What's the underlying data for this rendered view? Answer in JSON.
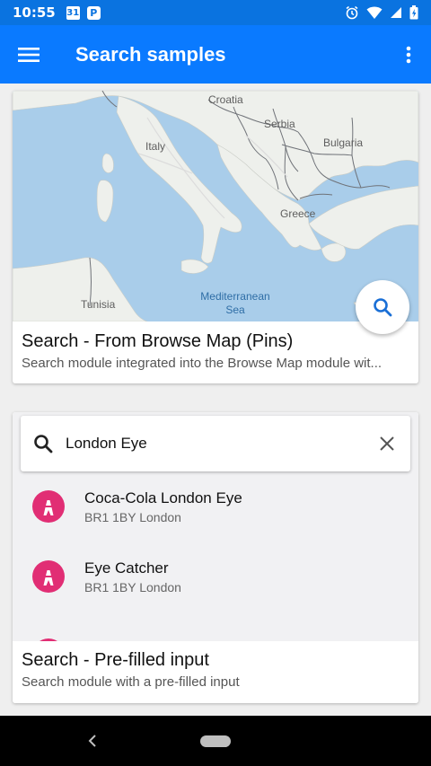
{
  "status_bar": {
    "time": "10:55",
    "calendar_day": "31",
    "parking_letter": "P"
  },
  "app_bar": {
    "title": "Search samples"
  },
  "card1": {
    "map_labels": {
      "croatia": "Croatia",
      "serbia": "Serbia",
      "bulgaria": "Bulgaria",
      "italy": "Italy",
      "greece": "Greece",
      "tunisia": "Tunisia",
      "sea_line1": "Mediterranean",
      "sea_line2": "Sea"
    },
    "title": "Search - From Browse Map (Pins)",
    "subtitle": "Search module integrated into the Browse Map module wit..."
  },
  "card2": {
    "search_value": "London Eye",
    "results": [
      {
        "name": "Coca-Cola London Eye",
        "address": "BR1 1BY London"
      },
      {
        "name": "Eye Catcher",
        "address": "BR1 1BY London"
      }
    ],
    "title": "Search - Pre-filled input",
    "subtitle": "Search module with a pre-filled input"
  },
  "colors": {
    "app_bar": "#0a7aff",
    "status_bar": "#0a73e0",
    "accent": "#1a6fd6",
    "pin": "#e12e74",
    "sea": "#a9cdea"
  }
}
